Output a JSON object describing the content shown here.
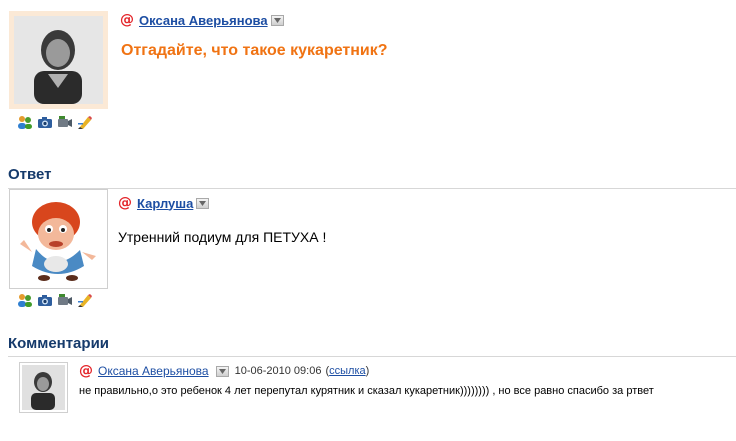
{
  "question": {
    "author": "Оксана Аверьянова",
    "title": "Отгадайте, что такое кукаретник?"
  },
  "answer": {
    "section_title": "Ответ",
    "author": "Карлуша",
    "text": "Утренний подиум для ПЕТУХА !"
  },
  "comments": {
    "section_title": "Комментарии",
    "items": [
      {
        "author": "Оксана Аверьянова",
        "datetime": "10-06-2010 09:06",
        "open_paren": "(",
        "link_label": "ссылка",
        "close_paren": ")",
        "text": "не правильно,о это ребенок 4 лет перепутал курятник и сказал кукаретник)))))))) , но все равно спасибо за ртвет"
      }
    ]
  },
  "icons": {
    "at_symbol": "@",
    "profile_actions": [
      "users-icon",
      "camera-icon",
      "video-camera-icon",
      "edit-pencil-icon"
    ],
    "colors": {
      "accent_orange": "#f07313",
      "link_blue": "#1d4ea3",
      "heading_navy": "#153a6b",
      "at_red": "#e4262b"
    }
  }
}
